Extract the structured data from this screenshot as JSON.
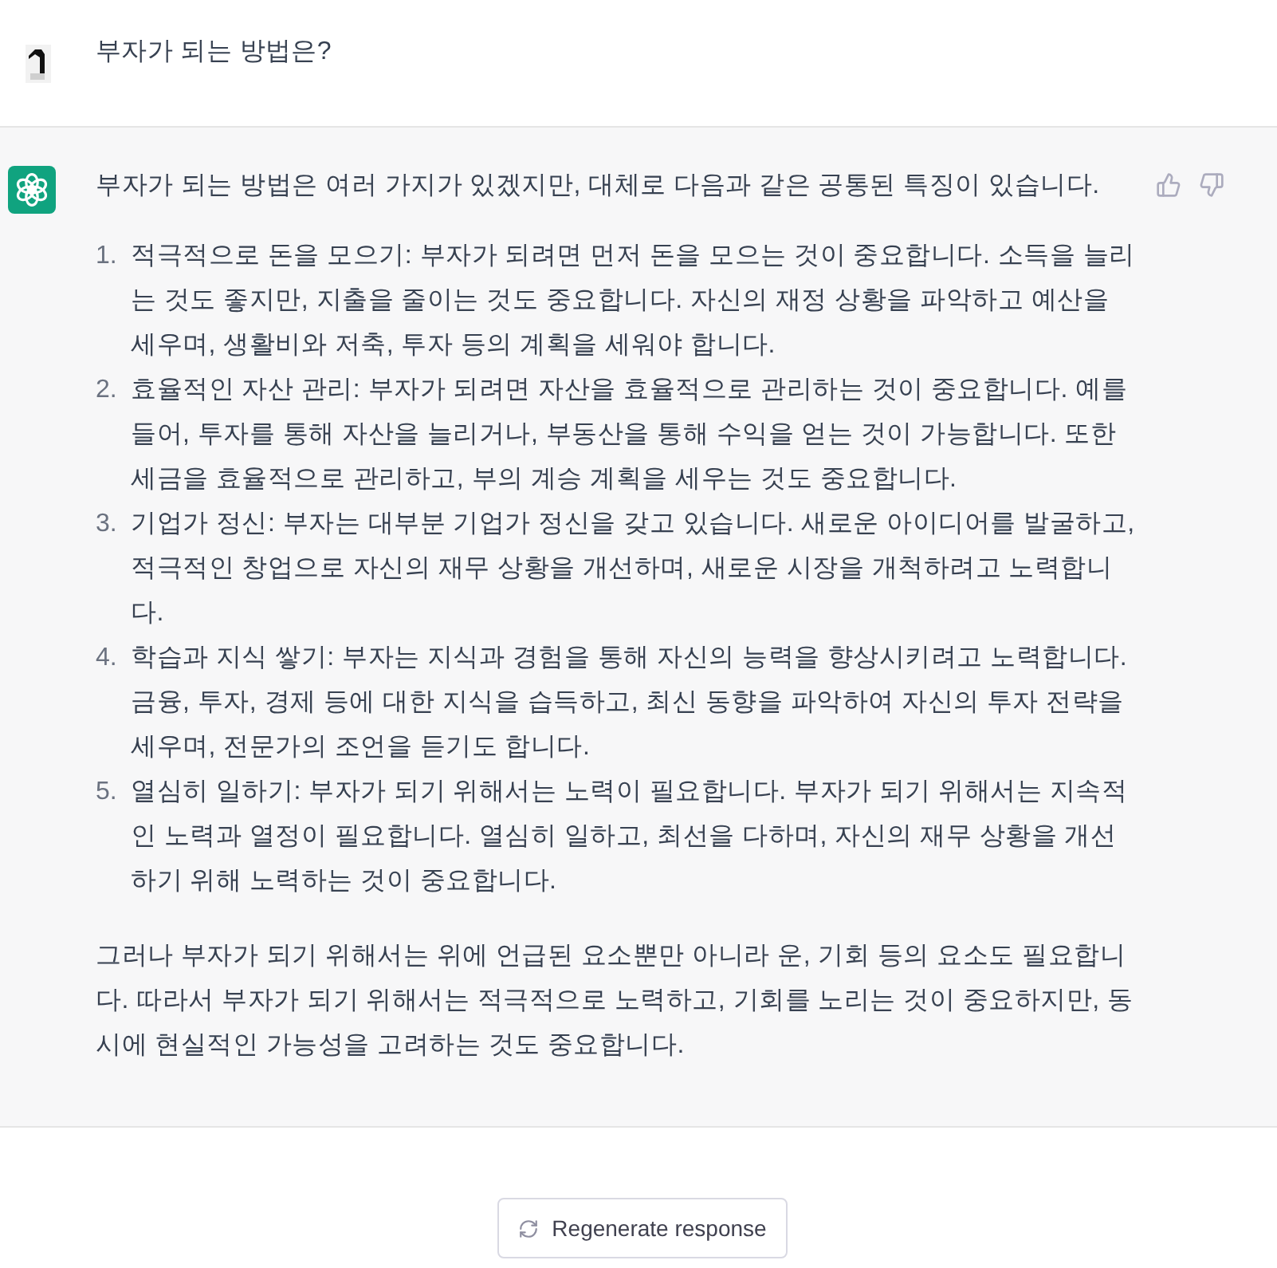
{
  "user_message": {
    "text": "부자가 되는 방법은?"
  },
  "assistant_message": {
    "intro": "부자가 되는 방법은 여러 가지가 있겠지만, 대체로 다음과 같은 공통된 특징이 있습니다.",
    "items": [
      {
        "number": "1.",
        "text": "적극적으로 돈을 모으기: 부자가 되려면 먼저 돈을 모으는 것이 중요합니다. 소득을 늘리는 것도 좋지만, 지출을 줄이는 것도 중요합니다. 자신의 재정 상황을 파악하고 예산을 세우며, 생활비와 저축, 투자 등의 계획을 세워야 합니다."
      },
      {
        "number": "2.",
        "text": "효율적인 자산 관리: 부자가 되려면 자산을 효율적으로 관리하는 것이 중요합니다. 예를 들어, 투자를 통해 자산을 늘리거나, 부동산을 통해 수익을 얻는 것이 가능합니다. 또한 세금을 효율적으로 관리하고, 부의 계승 계획을 세우는 것도 중요합니다."
      },
      {
        "number": "3.",
        "text": "기업가 정신: 부자는 대부분 기업가 정신을 갖고 있습니다. 새로운 아이디어를 발굴하고, 적극적인 창업으로 자신의 재무 상황을 개선하며, 새로운 시장을 개척하려고 노력합니다."
      },
      {
        "number": "4.",
        "text": "학습과 지식 쌓기: 부자는 지식과 경험을 통해 자신의 능력을 향상시키려고 노력합니다. 금융, 투자, 경제 등에 대한 지식을 습득하고, 최신 동향을 파악하여 자신의 투자 전략을 세우며, 전문가의 조언을 듣기도 합니다."
      },
      {
        "number": "5.",
        "text": "열심히 일하기: 부자가 되기 위해서는 노력이 필요합니다. 부자가 되기 위해서는 지속적인 노력과 열정이 필요합니다. 열심히 일하고, 최선을 다하며, 자신의 재무 상황을 개선하기 위해 노력하는 것이 중요합니다."
      }
    ],
    "closing": "그러나 부자가 되기 위해서는 위에 언급된 요소뿐만 아니라 운, 기회 등의 요소도 필요합니다. 따라서 부자가 되기 위해서는 적극적으로 노력하고, 기회를 노리는 것이 중요하지만, 동시에 현실적인 가능성을 고려하는 것도 중요합니다."
  },
  "regenerate_button": {
    "label": "Regenerate response"
  }
}
